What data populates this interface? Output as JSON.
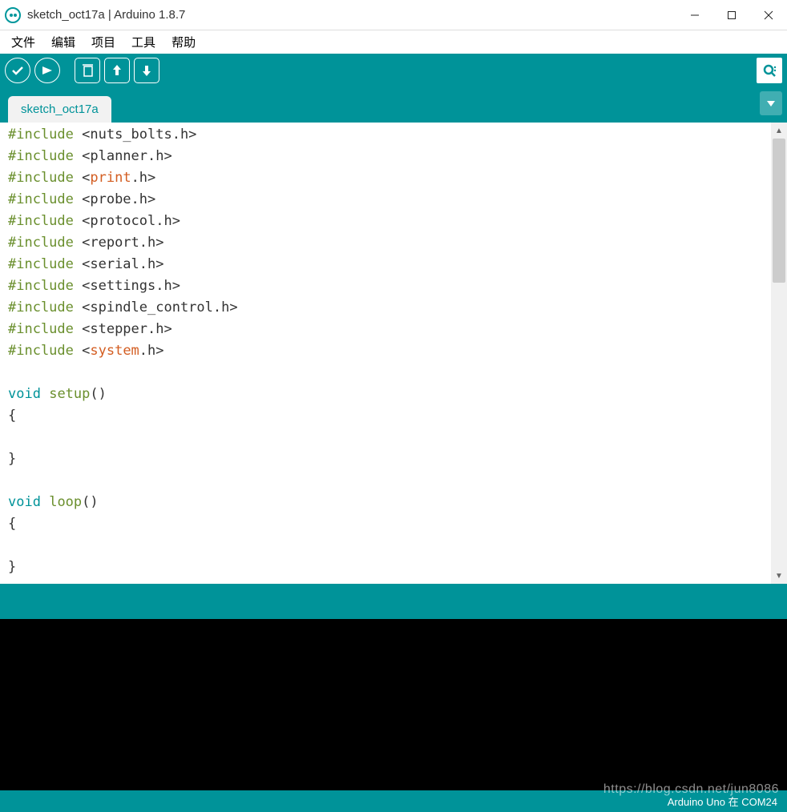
{
  "window": {
    "title": "sketch_oct17a | Arduino 1.8.7"
  },
  "menu": {
    "file": "文件",
    "edit": "编辑",
    "sketch": "项目",
    "tools": "工具",
    "help": "帮助"
  },
  "tab": {
    "name": "sketch_oct17a"
  },
  "code_lines": [
    [
      {
        "t": "#include",
        "c": "kw-preproc"
      },
      {
        "t": " <nuts_bolts.h>",
        "c": ""
      }
    ],
    [
      {
        "t": "#include",
        "c": "kw-preproc"
      },
      {
        "t": " <planner.h>",
        "c": ""
      }
    ],
    [
      {
        "t": "#include",
        "c": "kw-preproc"
      },
      {
        "t": " <",
        "c": ""
      },
      {
        "t": "print",
        "c": "kw-special"
      },
      {
        "t": ".h>",
        "c": ""
      }
    ],
    [
      {
        "t": "#include",
        "c": "kw-preproc"
      },
      {
        "t": " <probe.h>",
        "c": ""
      }
    ],
    [
      {
        "t": "#include",
        "c": "kw-preproc"
      },
      {
        "t": " <protocol.h>",
        "c": ""
      }
    ],
    [
      {
        "t": "#include",
        "c": "kw-preproc"
      },
      {
        "t": " <report.h>",
        "c": ""
      }
    ],
    [
      {
        "t": "#include",
        "c": "kw-preproc"
      },
      {
        "t": " <serial.h>",
        "c": ""
      }
    ],
    [
      {
        "t": "#include",
        "c": "kw-preproc"
      },
      {
        "t": " <settings.h>",
        "c": ""
      }
    ],
    [
      {
        "t": "#include",
        "c": "kw-preproc"
      },
      {
        "t": " <spindle_control.h>",
        "c": ""
      }
    ],
    [
      {
        "t": "#include",
        "c": "kw-preproc"
      },
      {
        "t": " <stepper.h>",
        "c": ""
      }
    ],
    [
      {
        "t": "#include",
        "c": "kw-preproc"
      },
      {
        "t": " <",
        "c": ""
      },
      {
        "t": "system",
        "c": "kw-special"
      },
      {
        "t": ".h>",
        "c": ""
      }
    ],
    [],
    [
      {
        "t": "void",
        "c": "kw-type"
      },
      {
        "t": " ",
        "c": ""
      },
      {
        "t": "setup",
        "c": "kw-func"
      },
      {
        "t": "()",
        "c": ""
      }
    ],
    [
      {
        "t": "{",
        "c": ""
      }
    ],
    [],
    [
      {
        "t": "}",
        "c": ""
      }
    ],
    [],
    [
      {
        "t": "void",
        "c": "kw-type"
      },
      {
        "t": " ",
        "c": ""
      },
      {
        "t": "loop",
        "c": "kw-func"
      },
      {
        "t": "()",
        "c": ""
      }
    ],
    [
      {
        "t": "{",
        "c": ""
      }
    ],
    [],
    [
      {
        "t": "}",
        "c": ""
      }
    ]
  ],
  "footer": {
    "board": "Arduino Uno 在 COM24",
    "watermark": "https://blog.csdn.net/jun8086"
  }
}
